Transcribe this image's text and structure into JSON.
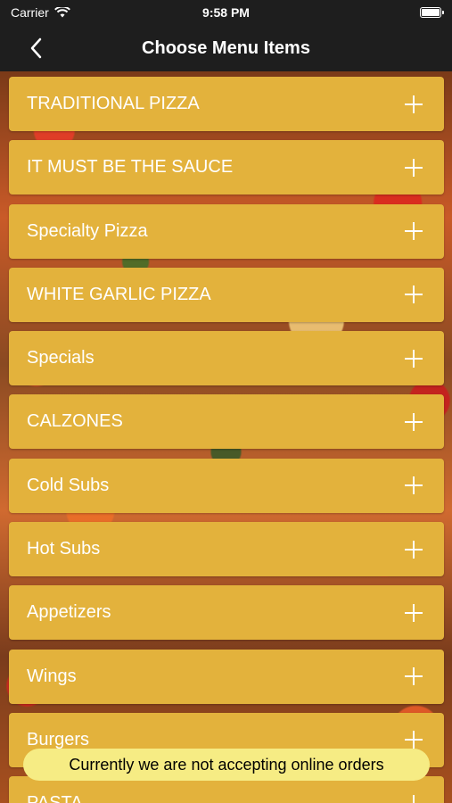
{
  "status_bar": {
    "carrier": "Carrier",
    "time": "9:58 PM"
  },
  "nav": {
    "title": "Choose Menu Items",
    "back_icon": "chevron-left-icon"
  },
  "menu": {
    "items": [
      {
        "label": "TRADITIONAL PIZZA"
      },
      {
        "label": "IT MUST BE THE SAUCE"
      },
      {
        "label": "Specialty Pizza"
      },
      {
        "label": "WHITE GARLIC PIZZA"
      },
      {
        "label": "Specials"
      },
      {
        "label": "CALZONES"
      },
      {
        "label": "Cold Subs"
      },
      {
        "label": "Hot Subs"
      },
      {
        "label": "Appetizers"
      },
      {
        "label": "Wings"
      },
      {
        "label": "Burgers"
      },
      {
        "label": "PASTA"
      }
    ],
    "expand_icon": "plus-icon",
    "item_color": "#e3b23c"
  },
  "toast": {
    "message": "Currently we are not accepting online orders",
    "background": "#f6ec84"
  }
}
